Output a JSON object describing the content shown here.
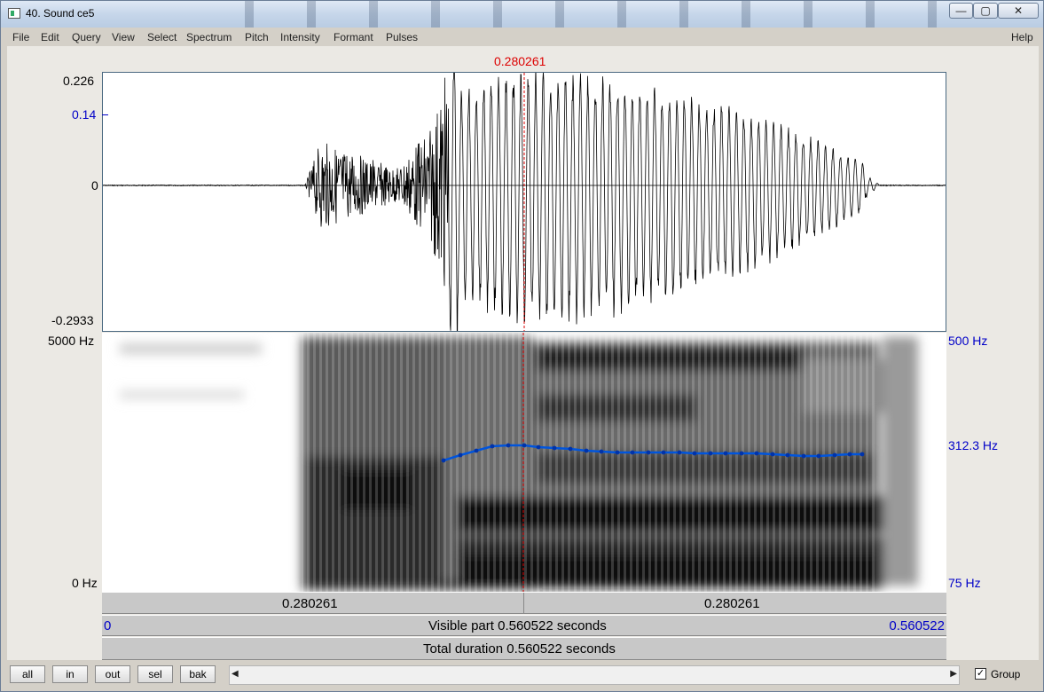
{
  "window": {
    "title": "40. Sound ce5",
    "min": "—",
    "max": "▢",
    "close": "✕"
  },
  "menu": [
    "File",
    "Edit",
    "Query",
    "View",
    "Select",
    "Spectrum",
    "Pitch",
    "Intensity",
    "Formant",
    "Pulses"
  ],
  "help": "Help",
  "cursor_time": "0.280261",
  "waveform": {
    "ymax": "0.226",
    "ymark": "0.14",
    "zero": "0",
    "ymin": "-0.2933"
  },
  "spectrogram": {
    "fmax": "5000 Hz",
    "fmin": "0 Hz"
  },
  "pitch": {
    "max": "500 Hz",
    "current": "312.3 Hz",
    "min": "75 Hz"
  },
  "bars": {
    "left_time": "0.280261",
    "right_time": "0.280261",
    "start": "0",
    "visible": "Visible part 0.560522 seconds",
    "end": "0.560522",
    "total": "Total duration 0.560522 seconds"
  },
  "buttons": [
    "all",
    "in",
    "out",
    "sel",
    "bak"
  ],
  "group": {
    "label": "Group",
    "checked": "✓"
  },
  "colors": {
    "cursor": "#d00000",
    "pitch": "#0055dd",
    "axis_blue": "#0000c8"
  }
}
